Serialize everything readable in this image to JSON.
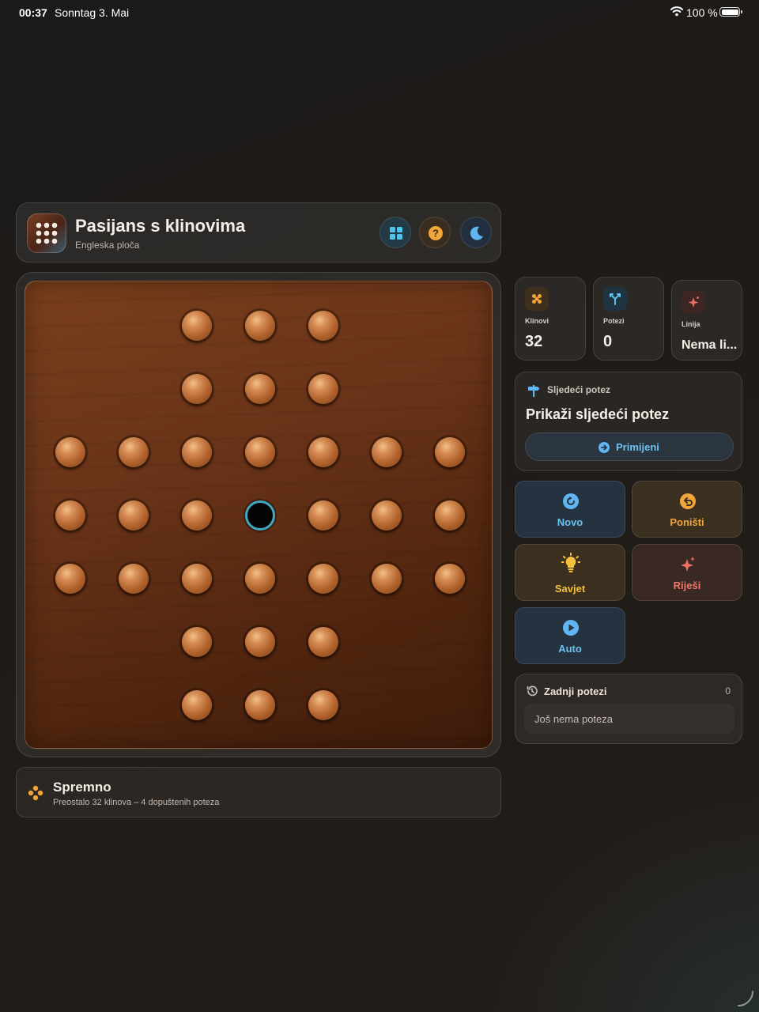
{
  "status_bar": {
    "time": "00:37",
    "date": "Sonntag 3. Mai",
    "battery": "100 %"
  },
  "header": {
    "title": "Pasijans s klinovima",
    "subtitle": "Engleska ploča",
    "icons": [
      "board-layout-icon",
      "help-icon",
      "dark-mode-icon"
    ]
  },
  "board": {
    "type": "english",
    "rows": [
      "..xxx..",
      "..xxx..",
      "xxxxxxx",
      "xxxoxxx",
      "xxxxxxx",
      "..xxx..",
      "..xxx.."
    ],
    "legend": {
      "x": "peg",
      "o": "empty-hole-selected",
      ".": "off-board"
    },
    "colors": {
      "peg": "#c17236",
      "hole_ring": "#3fa9c4",
      "board": "#6a3419"
    }
  },
  "status": {
    "title": "Spremno",
    "subtitle": "Preostalo 32 klinova – 4 dopuštenih poteza"
  },
  "stats": [
    {
      "label": "Klinovi",
      "value": "32",
      "icon": "pegs-icon",
      "color": "#f0a43a"
    },
    {
      "label": "Potezi",
      "value": "0",
      "icon": "moves-icon",
      "color": "#5cc3f0"
    },
    {
      "label": "Linija",
      "value": "Nema li...",
      "icon": "sparkle-icon",
      "color": "#f07060"
    }
  ],
  "next_move": {
    "label": "Sljedeći potez",
    "title": "Prikaži sljedeći potez",
    "apply_label": "Primijeni"
  },
  "actions": {
    "new": "Novo",
    "undo": "Poništi",
    "hint": "Savjet",
    "solve": "Riješi",
    "auto": "Auto"
  },
  "recent": {
    "title": "Zadnji potezi",
    "count": "0",
    "empty": "Još nema poteza"
  }
}
